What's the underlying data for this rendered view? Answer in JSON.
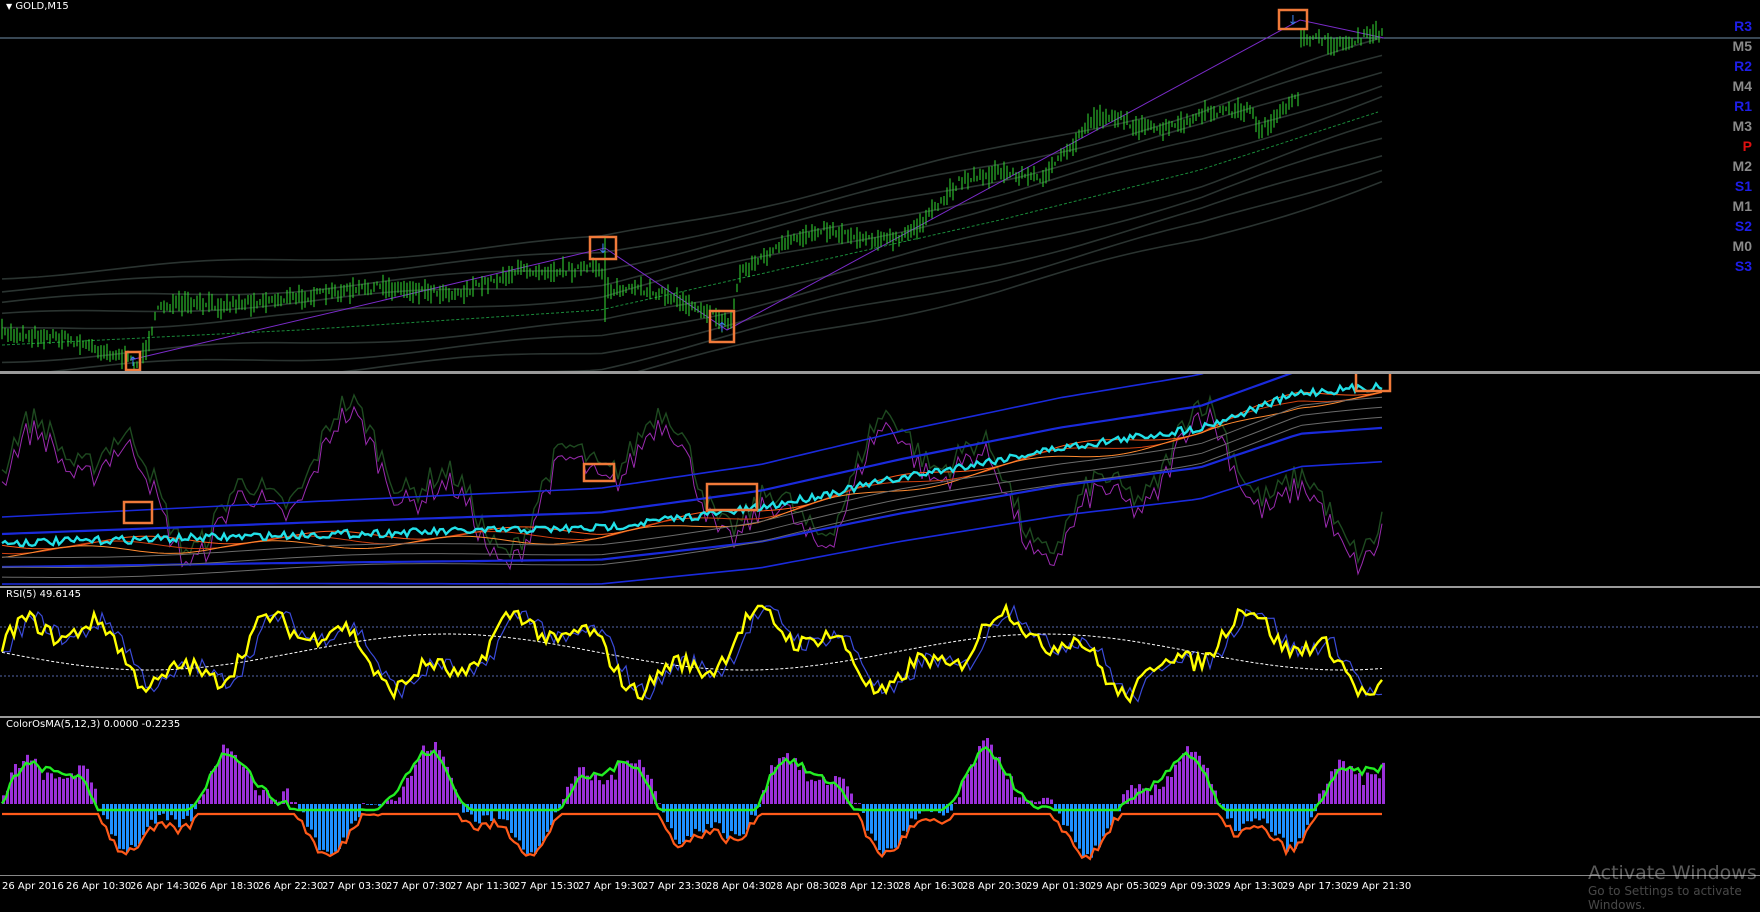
{
  "main_pane": {
    "symbol_label": "GOLD,M15",
    "pivot_levels": [
      {
        "label": "R3",
        "color": "#1e1ee8"
      },
      {
        "label": "M5",
        "color": "#8a8a8a"
      },
      {
        "label": "R2",
        "color": "#1e1ee8"
      },
      {
        "label": "M4",
        "color": "#8a8a8a"
      },
      {
        "label": "R1",
        "color": "#1e1ee8"
      },
      {
        "label": "M3",
        "color": "#8a8a8a"
      },
      {
        "label": "P",
        "color": "#e01010"
      },
      {
        "label": "M2",
        "color": "#8a8a8a"
      },
      {
        "label": "S1",
        "color": "#1e1ee8"
      },
      {
        "label": "M1",
        "color": "#8a8a8a"
      },
      {
        "label": "S2",
        "color": "#1e1ee8"
      },
      {
        "label": "M0",
        "color": "#8a8a8a"
      },
      {
        "label": "S3",
        "color": "#1e1ee8"
      }
    ]
  },
  "rsi_pane": {
    "label": "RSI(5) 49.6145"
  },
  "osma_pane": {
    "label": "ColorOsMA(5,12,3) 0.0000 -0.2235"
  },
  "time_axis": {
    "ticks": [
      "26 Apr 2016",
      "26 Apr 10:30",
      "26 Apr 14:30",
      "26 Apr 18:30",
      "26 Apr 22:30",
      "27 Apr 03:30",
      "27 Apr 07:30",
      "27 Apr 11:30",
      "27 Apr 15:30",
      "27 Apr 19:30",
      "27 Apr 23:30",
      "28 Apr 04:30",
      "28 Apr 08:30",
      "28 Apr 12:30",
      "28 Apr 16:30",
      "28 Apr 20:30",
      "29 Apr 01:30",
      "29 Apr 05:30",
      "29 Apr 09:30",
      "29 Apr 13:30",
      "29 Apr 17:30",
      "29 Apr 21:30"
    ]
  },
  "watermark": {
    "title": "Activate Windows",
    "subtitle": "Go to Settings to activate Windows."
  },
  "colors": {
    "candles": "#33dd33",
    "rsi": "#ffff00",
    "osma_up": "#9b30d9",
    "osma_down": "#1e90ff",
    "osma_signal": "#22ee22",
    "osma_line": "#ff5a1a",
    "marker_box": "#f07a3a",
    "price_line": "#6f8ea8",
    "blue_band": "#1a2adc",
    "cyan_line": "#22e0e8"
  }
}
